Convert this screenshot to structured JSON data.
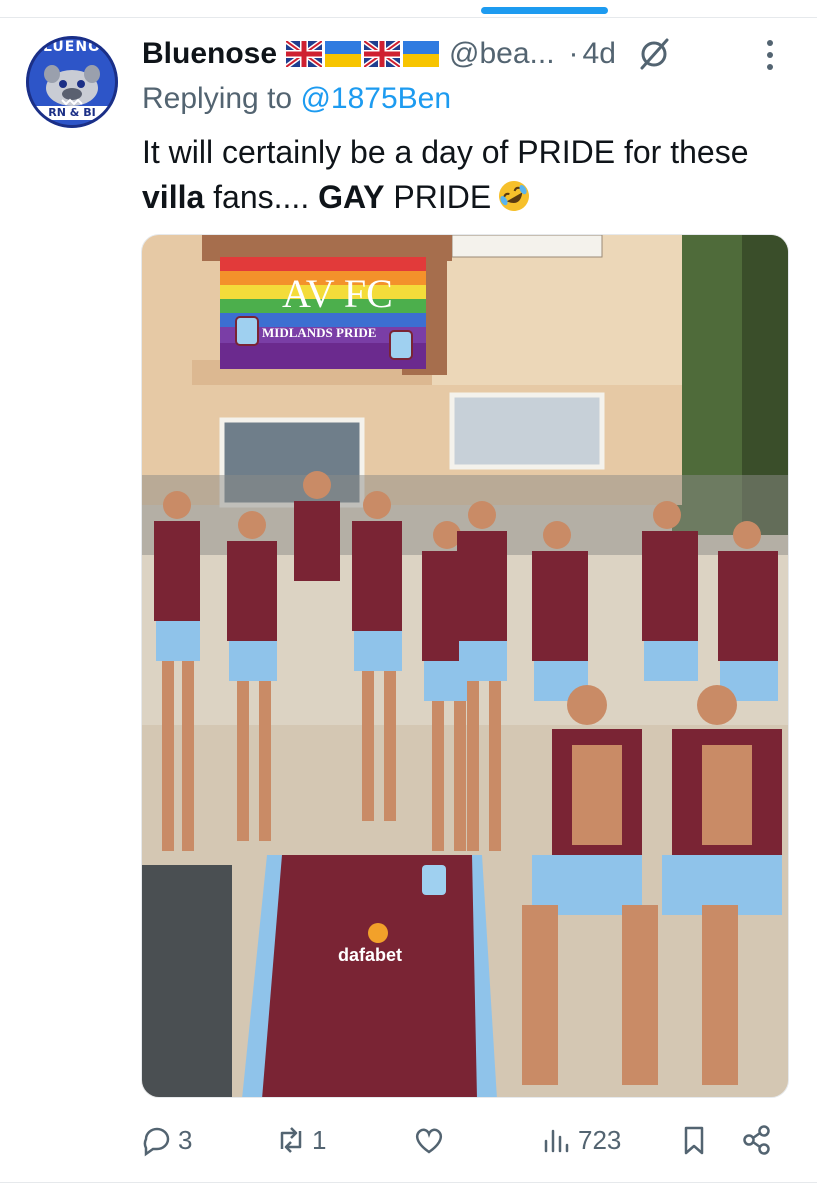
{
  "tweet": {
    "display_name": "Bluenose",
    "handle": "@bea...",
    "separator": "·",
    "time": "4d",
    "reply_prefix": "Replying to ",
    "reply_mention": "@1875Ben",
    "text": {
      "p1": "It will certainly be a day of PRIDE for these ",
      "b1": "villa",
      "p2": " fans.... ",
      "b2": "GAY",
      "p3": " PRIDE"
    },
    "emoji": "rolling-on-floor-laughing",
    "flags": [
      "union-jack",
      "ukraine",
      "union-jack",
      "ukraine"
    ]
  },
  "avatar": {
    "top_text": "LUENO",
    "bottom_text": "RN & BI"
  },
  "media": {
    "banner_title": "AV FC",
    "banner_subtitle": "MIDLANDS PRIDE",
    "shirt_sponsor": "dafabet"
  },
  "actions": {
    "replies": "3",
    "retweets": "1",
    "likes": "",
    "views": "723"
  },
  "colors": {
    "accent": "#1d9bf0",
    "secondary_text": "#536471",
    "claret": "#7a2434",
    "villa_blue": "#8fc3ea"
  }
}
